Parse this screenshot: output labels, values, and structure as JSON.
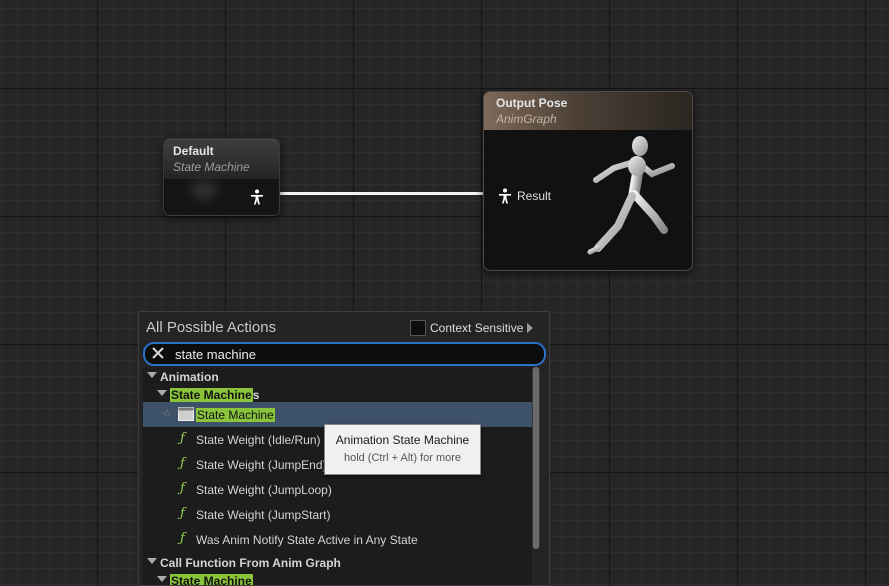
{
  "graph": {
    "default_node": {
      "title": "Default",
      "subtitle": "State Machine"
    },
    "output_node": {
      "title": "Output Pose",
      "subtitle": "AnimGraph",
      "pin_label": "Result"
    }
  },
  "actions_panel": {
    "title": "All Possible Actions",
    "context_sensitive_label": "Context Sensitive",
    "search_value": "state machine",
    "items": [
      {
        "kind": "category",
        "label": "Animation"
      },
      {
        "kind": "subcategory",
        "match": "State Machine",
        "rest": "s"
      },
      {
        "kind": "entry",
        "match": "State Machine",
        "rest": "",
        "selected": true,
        "icon": "state-machine-icon"
      },
      {
        "kind": "function",
        "label": "State Weight (Idle/Run)",
        "icon": "function-icon"
      },
      {
        "kind": "function",
        "label": "State Weight (JumpEnd)",
        "icon": "function-icon"
      },
      {
        "kind": "function",
        "label": "State Weight (JumpLoop)",
        "icon": "function-icon"
      },
      {
        "kind": "function",
        "label": "State Weight (JumpStart)",
        "icon": "function-icon"
      },
      {
        "kind": "function",
        "label": "Was Anim Notify State Active in Any State",
        "icon": "function-icon"
      },
      {
        "kind": "category",
        "label": "Call Function From Anim Graph"
      },
      {
        "kind": "subcategory",
        "match": "State Machine",
        "rest": ""
      }
    ]
  },
  "tooltip": {
    "title": "Animation State Machine",
    "hint": "hold (Ctrl + Alt) for more"
  },
  "colors": {
    "highlight": "#8ac43a",
    "selection": "#3d5168",
    "search_border": "#2b70c9",
    "wire": "#f4f4f4"
  }
}
